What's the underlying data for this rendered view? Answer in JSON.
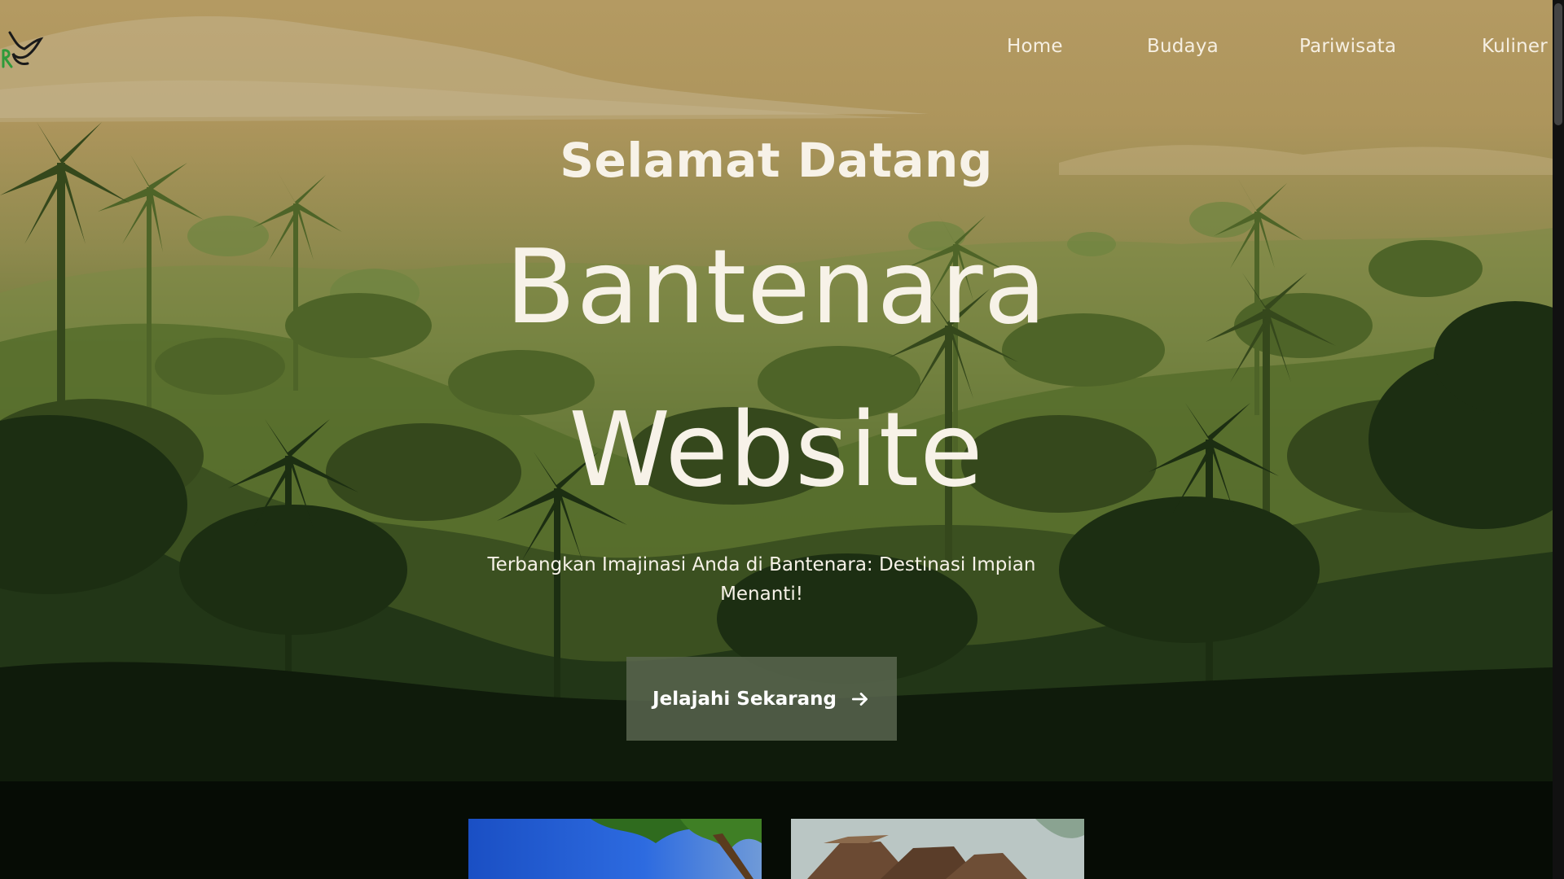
{
  "nav": {
    "items": [
      {
        "label": "Home"
      },
      {
        "label": "Budaya"
      },
      {
        "label": "Pariwisata"
      },
      {
        "label": "Kuliner"
      }
    ]
  },
  "hero": {
    "welcome": "Selamat Datang",
    "title_line1": "Bantenara",
    "title_line2": "Website",
    "subtitle": "Terbangkan Imajinasi Anda di Bantenara: Destinasi Impian Menanti!",
    "cta_label": "Jelajahi Sekarang",
    "cta_icon": "arrow-right-icon"
  },
  "colors": {
    "sky_top": "#b49a62",
    "forest_dark": "#1d2d12",
    "text": "#f7f2e8",
    "cta_bg": "#5c6850",
    "logo_green": "#2f9a3a"
  }
}
